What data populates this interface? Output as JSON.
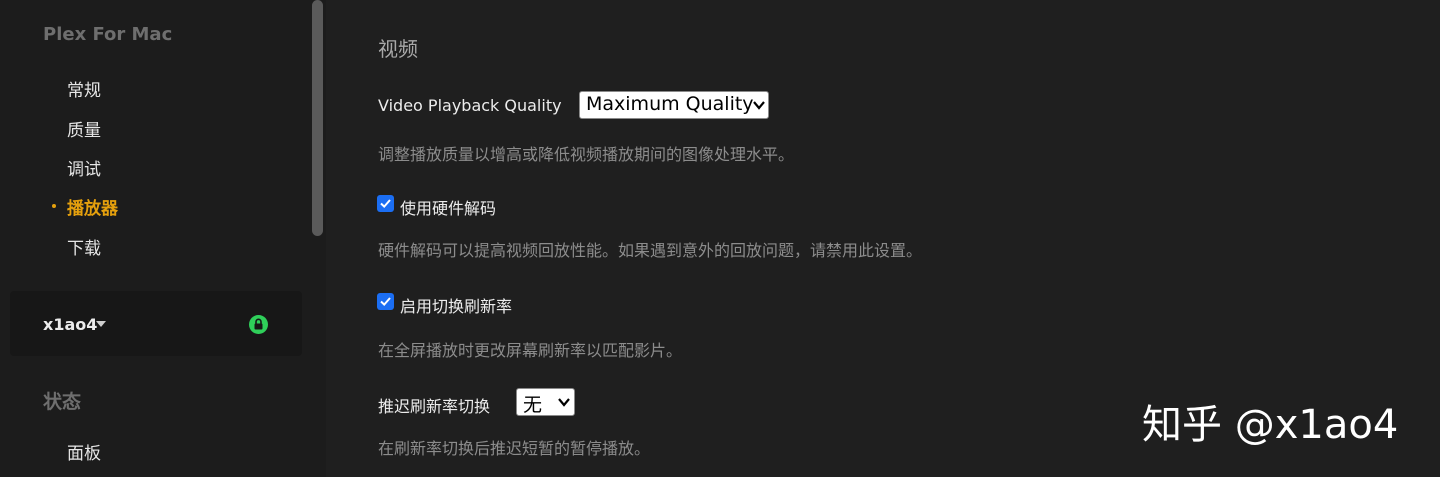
{
  "sidebar": {
    "app_title": "Plex For Mac",
    "items": [
      {
        "label": "常规",
        "active": false
      },
      {
        "label": "质量",
        "active": false
      },
      {
        "label": "调试",
        "active": false
      },
      {
        "label": "播放器",
        "active": true
      },
      {
        "label": "下载",
        "active": false
      }
    ],
    "account": {
      "name": "x1ao4",
      "lock_icon": "lock-icon",
      "lock_color": "#2fcf5a"
    },
    "status_header": "状态",
    "status_items": [
      {
        "label": "面板"
      }
    ]
  },
  "main": {
    "title": "视频",
    "video_quality": {
      "label": "Video Playback Quality",
      "value": "Maximum Quality",
      "help": "调整播放质量以增高或降低视频播放期间的图像处理水平。"
    },
    "hw_decode": {
      "label": "使用硬件解码",
      "checked": true,
      "help": "硬件解码可以提高视频回放性能。如果遇到意外的回放问题，请禁用此设置。"
    },
    "refresh_switch": {
      "label": "启用切换刷新率",
      "checked": true,
      "help": "在全屏播放时更改屏幕刷新率以匹配影片。"
    },
    "refresh_delay": {
      "label": "推迟刷新率切换",
      "value": "无",
      "help": "在刷新率切换后推迟短暂的暂停播放。"
    }
  },
  "watermark": "知乎 @x1ao4",
  "colors": {
    "accent": "#e5a00d",
    "checkbox": "#1b6ef3",
    "lock": "#2fcf5a"
  }
}
